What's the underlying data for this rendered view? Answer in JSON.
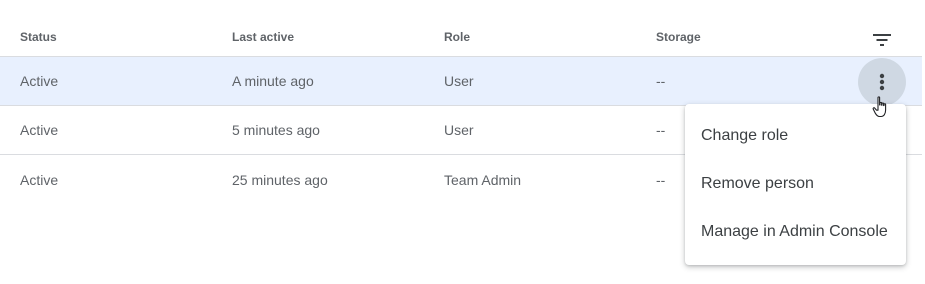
{
  "table": {
    "columns": {
      "status": "Status",
      "last_active": "Last active",
      "role": "Role",
      "storage": "Storage"
    },
    "rows": [
      {
        "status": "Active",
        "last_active": "A minute ago",
        "role": "User",
        "storage": "--",
        "selected": true
      },
      {
        "status": "Active",
        "last_active": "5 minutes ago",
        "role": "User",
        "storage": "--",
        "selected": false
      },
      {
        "status": "Active",
        "last_active": "25 minutes ago",
        "role": "Team Admin",
        "storage": "--",
        "selected": false
      }
    ]
  },
  "menu": {
    "items": [
      {
        "label": "Change role"
      },
      {
        "label": "Remove person"
      },
      {
        "label": "Manage in Admin Console"
      }
    ]
  },
  "icons": {
    "filter": "filter-icon",
    "more": "more-vert-icon",
    "cursor": "hand-pointer-icon"
  },
  "colors": {
    "selected_row": "#e8f0fe",
    "active_button": "#cfd8e3",
    "divider": "#dadce0"
  }
}
